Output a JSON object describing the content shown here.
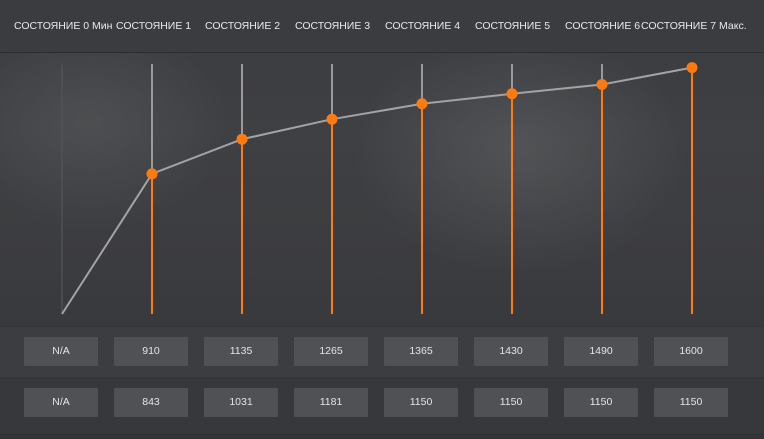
{
  "states": [
    {
      "label": "СОСТОЯНИЕ 0 Мин",
      "value1": "N/A",
      "value2": "N/A",
      "curve": 0,
      "na": true
    },
    {
      "label": "СОСТОЯНИЕ 1",
      "value1": "910",
      "value2": "843",
      "curve": 910,
      "na": false
    },
    {
      "label": "СОСТОЯНИЕ 2",
      "value1": "1135",
      "value2": "1031",
      "curve": 1135,
      "na": false
    },
    {
      "label": "СОСТОЯНИЕ 3",
      "value1": "1265",
      "value2": "1181",
      "curve": 1265,
      "na": false
    },
    {
      "label": "СОСТОЯНИЕ 4",
      "value1": "1365",
      "value2": "1150",
      "curve": 1365,
      "na": false
    },
    {
      "label": "СОСТОЯНИЕ 5",
      "value1": "1430",
      "value2": "1150",
      "curve": 1430,
      "na": false
    },
    {
      "label": "СОСТОЯНИЕ 6",
      "value1": "1490",
      "value2": "1150",
      "curve": 1490,
      "na": false
    },
    {
      "label": "СОСТОЯНИЕ 7 Макс.",
      "value1": "1600",
      "value2": "1150",
      "curve": 1600,
      "na": false
    }
  ],
  "colors": {
    "accent": "#ff7a0f",
    "curve_line": "#a3a3a5",
    "guide_line": "#9a9a9c"
  }
}
